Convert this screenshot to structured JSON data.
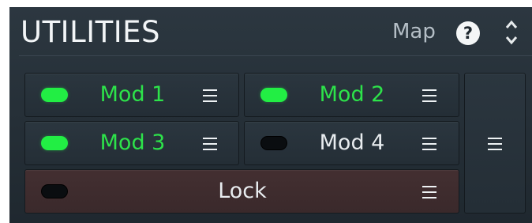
{
  "header": {
    "title": "UTILITIES",
    "map_label": "Map",
    "help_symbol": "?",
    "collapse_icon": "chevron-up-down-icon"
  },
  "modulators": [
    {
      "label": "Mod 1",
      "active": true,
      "menu_icon": "hamburger-menu-icon"
    },
    {
      "label": "Mod 2",
      "active": true,
      "menu_icon": "hamburger-menu-icon"
    },
    {
      "label": "Mod 3",
      "active": true,
      "menu_icon": "hamburger-menu-icon"
    },
    {
      "label": "Mod 4",
      "active": false,
      "menu_icon": "hamburger-menu-icon"
    }
  ],
  "lock": {
    "label": "Lock",
    "active": false,
    "menu_icon": "hamburger-menu-icon"
  },
  "side_menu": {
    "icon": "hamburger-menu-icon"
  },
  "colors": {
    "panel_bg": "#27323a",
    "active_led": "#22ee44",
    "active_text": "#2de34a",
    "lock_bg": "#3e2c2e"
  }
}
